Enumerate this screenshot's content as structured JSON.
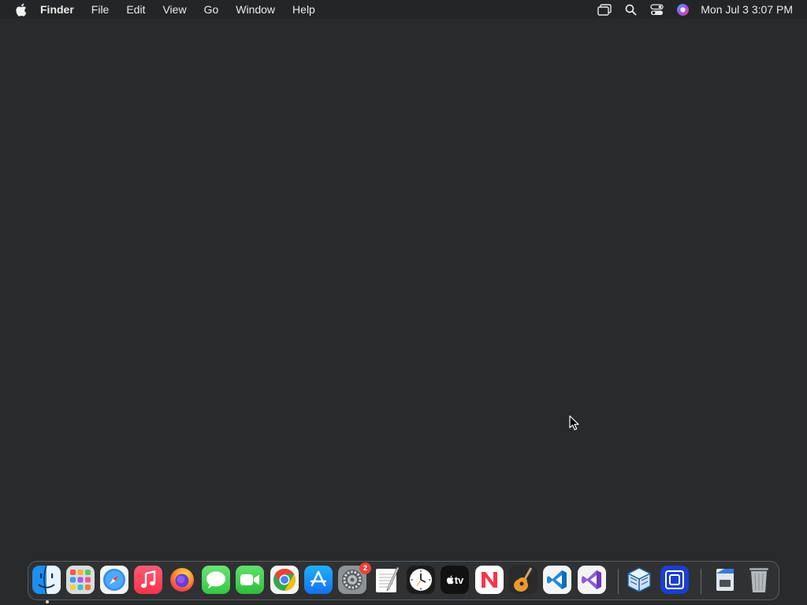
{
  "menubar": {
    "apple_icon": "apple-icon",
    "app_name": "Finder",
    "items": [
      "File",
      "Edit",
      "View",
      "Go",
      "Window",
      "Help"
    ],
    "status_icons": [
      "stage-manager-icon",
      "spotlight-search-icon",
      "control-center-icon",
      "siri-icon"
    ],
    "clock": "Mon Jul 3  3:07 PM"
  },
  "dock": {
    "apps": [
      {
        "name": "Finder",
        "icon": "finder-icon",
        "running": true
      },
      {
        "name": "Launchpad",
        "icon": "launchpad-icon"
      },
      {
        "name": "Safari",
        "icon": "safari-icon"
      },
      {
        "name": "Music",
        "icon": "music-icon"
      },
      {
        "name": "Firefox",
        "icon": "firefox-icon"
      },
      {
        "name": "Messages",
        "icon": "messages-icon"
      },
      {
        "name": "FaceTime",
        "icon": "facetime-icon"
      },
      {
        "name": "Chrome",
        "icon": "chrome-icon"
      },
      {
        "name": "App Store",
        "icon": "app-store-icon"
      },
      {
        "name": "System Settings",
        "icon": "system-settings-icon",
        "badge": "2"
      },
      {
        "name": "TextEdit",
        "icon": "textedit-icon"
      },
      {
        "name": "Clock",
        "icon": "clock-icon"
      },
      {
        "name": "TV",
        "icon": "apple-tv-icon",
        "label": "tv"
      },
      {
        "name": "News",
        "icon": "news-icon"
      },
      {
        "name": "GarageBand",
        "icon": "garageband-icon"
      },
      {
        "name": "Visual Studio Code",
        "icon": "vscode-icon"
      },
      {
        "name": "Visual Studio",
        "icon": "visual-studio-icon"
      },
      {
        "name": "VirtualBox",
        "icon": "virtualbox-icon"
      },
      {
        "name": "Screen Sharing",
        "icon": "screen-sharing-icon"
      },
      {
        "name": "Preview",
        "icon": "preview-document-icon"
      },
      {
        "name": "Trash",
        "icon": "trash-icon"
      }
    ]
  },
  "colors": {
    "desktop": "#282a2b",
    "menubar": "#232526",
    "badge": "#e8413a"
  }
}
